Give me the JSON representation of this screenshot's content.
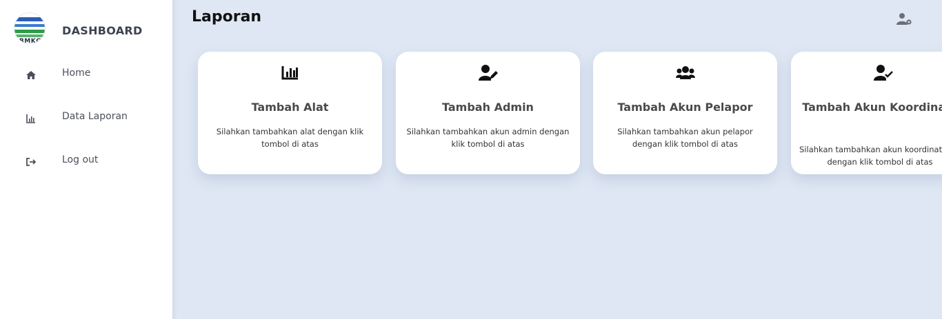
{
  "sidebar": {
    "brand_title": "DASHBOARD",
    "logo_text": "BMKG",
    "items": [
      {
        "label": "Home",
        "icon": "home-icon"
      },
      {
        "label": "Data Laporan",
        "icon": "bar-chart-icon"
      },
      {
        "label": "Log out",
        "icon": "logout-icon"
      }
    ]
  },
  "header": {
    "title": "Laporan",
    "user_icon": "user-settings-icon"
  },
  "cards": [
    {
      "title": "Tambah Alat",
      "desc": "Silahkan tambahkan alat dengan klik tombol di atas",
      "icon": "chart-icon"
    },
    {
      "title": "Tambah Admin",
      "desc": "Silahkan tambahkan akun admin dengan klik tombol di atas",
      "icon": "user-edit-icon"
    },
    {
      "title": "Tambah Akun Pelapor",
      "desc": "Silahkan tambahkan akun pelapor dengan klik tombol di atas",
      "icon": "users-icon"
    },
    {
      "title": "Tambah Akun Koordinator",
      "desc_line1": "Silahkan tambahkan akun koordinator",
      "desc_line2": "dengan klik tombol di atas",
      "icon": "user-check-icon"
    }
  ],
  "colors": {
    "main_bg": "#dfe7f4",
    "card_bg": "#ffffff",
    "text_dark": "#121212"
  }
}
